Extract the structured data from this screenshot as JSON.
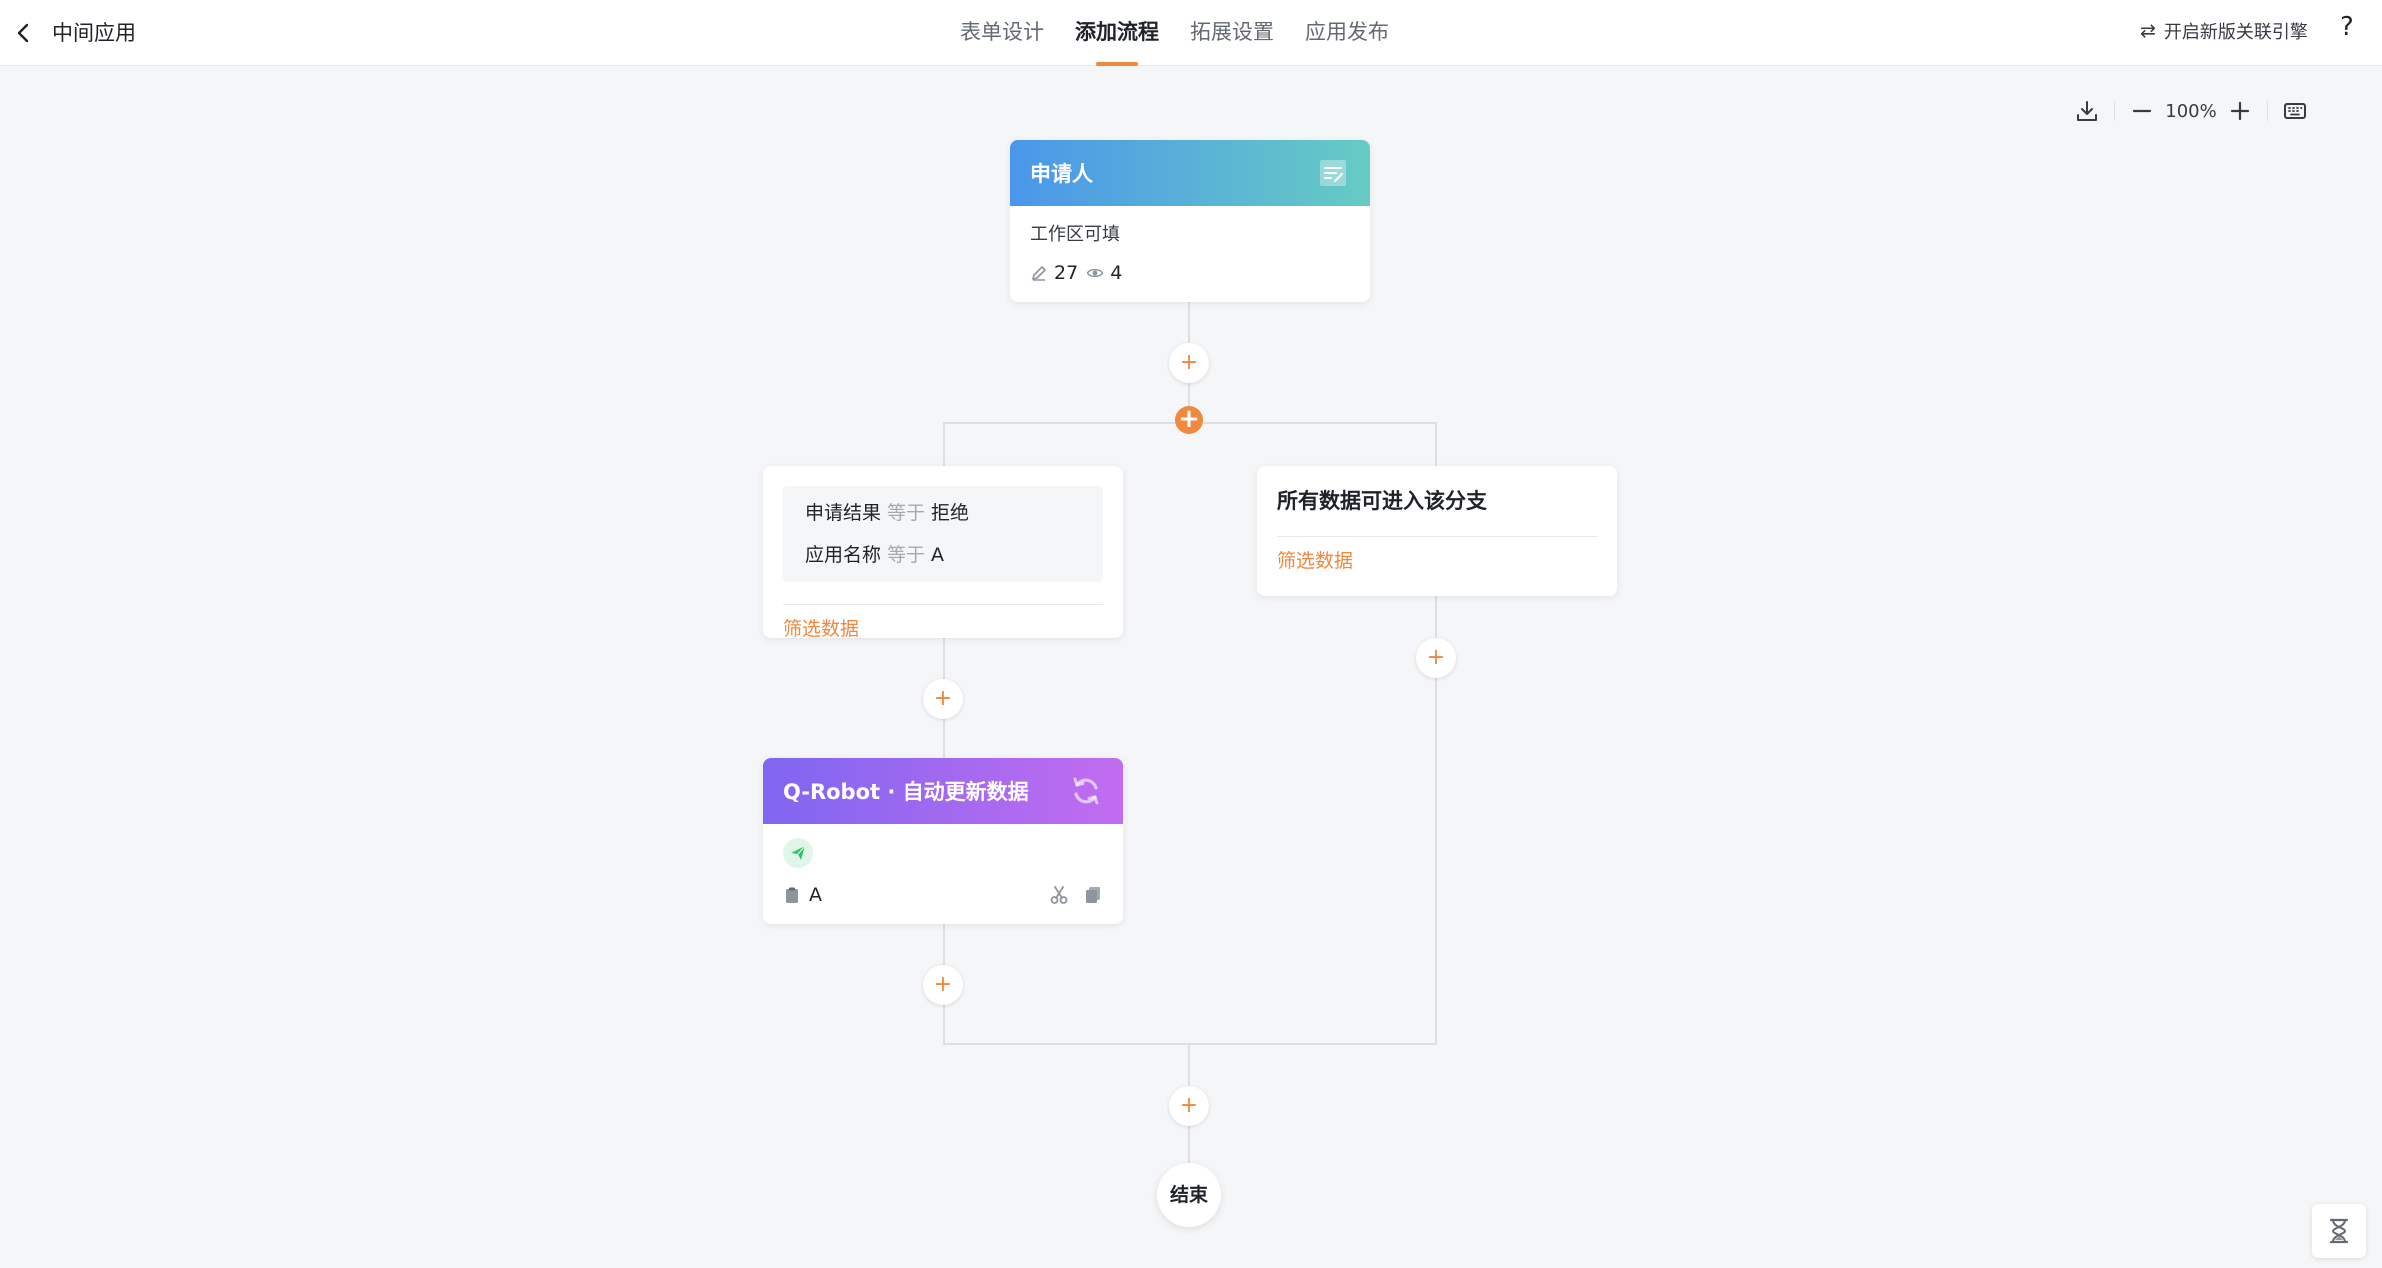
{
  "header": {
    "back_icon": "chevron-left-icon",
    "app_title": "中间应用",
    "tabs": [
      {
        "label": "表单设计",
        "active": false
      },
      {
        "label": "添加流程",
        "active": true
      },
      {
        "label": "拓展设置",
        "active": false
      },
      {
        "label": "应用发布",
        "active": false
      }
    ],
    "engine_link_icon": "swap-icon",
    "engine_link_label": "开启新版关联引擎",
    "help_label": "?"
  },
  "toolbar": {
    "download_icon": "download-icon",
    "zoom_out_icon": "minus-icon",
    "zoom_level": "100%",
    "zoom_in_icon": "plus-icon",
    "keyboard_icon": "keyboard-icon"
  },
  "flow": {
    "add_symbol": "+",
    "branch_add_symbol": "+",
    "applicant": {
      "title": "申请人",
      "subtitle": "工作区可填",
      "editable_count": "27",
      "viewable_count": "4",
      "header_icon": "form-icon"
    },
    "branch_left": {
      "conditions": [
        {
          "field": "申请结果",
          "op": "等于",
          "value": "拒绝"
        },
        {
          "field": "应用名称",
          "op": "等于",
          "value": "A"
        }
      ],
      "filter_label": "筛选数据"
    },
    "branch_right": {
      "title": "所有数据可进入该分支",
      "filter_label": "筛选数据"
    },
    "robot": {
      "title": "Q-Robot · 自动更新数据",
      "header_icon": "sync-icon",
      "action_icon": "send-icon",
      "target_icon": "clipboard-icon",
      "target_label": "A",
      "cut_icon": "scissors-icon",
      "copy_icon": "copy-icon"
    },
    "end_label": "结束"
  },
  "corner_icon": "hourglass-icon",
  "colors": {
    "accent": "#f0883e",
    "applicant_gradient": [
      "#4b96ea",
      "#66cbc4"
    ],
    "robot_gradient": [
      "#7f66f0",
      "#c26cf0"
    ],
    "canvas_bg": "#f5f6f8"
  }
}
